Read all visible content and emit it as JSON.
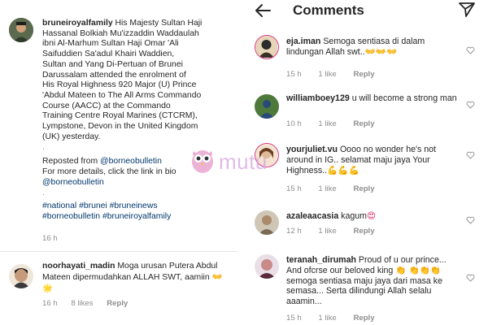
{
  "post": {
    "username": "bruneiroyalfamily",
    "caption_lines": [
      "His Majesty Sultan Haji",
      "Hassanal Bolkiah Mu'izzaddin Waddaulah",
      "ibni Al-Marhum Sultan Haji Omar 'Ali",
      "Saifuddien Sa'adul Khairi Waddien,",
      "Sultan and Yang Di-Pertuan of Brunei",
      "Darussalam attended the enrolment of",
      "His Royal Highness 920 Major (U) Prince",
      "'Abdul Mateen to The All Arms Commando",
      "Course (AACC) at the Commando",
      "Training Centre Royal Marines (CTCRM),",
      "Lympstone, Devon in the United Kingdom",
      "(UK) yesterday."
    ],
    "dot1": ".",
    "repost_prefix": "Reposted from ",
    "repost_link": "@borneobulletin",
    "more_details": "For more details, click the link in bio",
    "bio_link": "@borneobulletin",
    "dot2": ".",
    "hashtags_line1": "#national #brunei #bruneinews",
    "hashtags_line2": "#borneobulletin #bruneiroyalfamily",
    "time": "16 h"
  },
  "left_comment": {
    "username": "noorhayati_madin",
    "text": "Moga urusan Putera Abdul Mateen dipermudahkan ALLAH SWT, aamiin",
    "emoji": "👐🌟",
    "time": "16 h",
    "likes": "8 likes",
    "reply": "Reply"
  },
  "watermark": {
    "text": "mutu"
  },
  "comments_screen": {
    "title": "Comments",
    "comments": [
      {
        "username": "eja.iman",
        "text": "Semoga sentiasa di dalam lindungan Allah swt..",
        "emoji": "👐👐👐",
        "time": "15 h",
        "likes": "1 like",
        "reply": "Reply"
      },
      {
        "username": "williamboey129",
        "text": "u will become a strong man",
        "emoji": "",
        "time": "10 h",
        "likes": "1 like",
        "reply": "Reply"
      },
      {
        "username": "yourjuliet.vu",
        "text": "Oooo no wonder he's not around in IG.. selamat maju jaya Your Highness..",
        "emoji": "💪💪💪",
        "time": "15 h",
        "likes": "1 like",
        "reply": "Reply"
      },
      {
        "username": "azaleaacasia",
        "text": "kagum",
        "emoji": "😍",
        "time": "12 h",
        "likes": "1 like",
        "reply": "Reply"
      },
      {
        "username": "teranah_dirumah",
        "text": "Proud of u our prince... And ofcrse our beloved king",
        "text2": "semoga sentiasa maju jaya dari masa ke semasa... Serta dilindungi Allah selalu aaamin...",
        "emoji": "👏",
        "emoji2": "👏👏👏",
        "time": "15 h",
        "likes": "1 like",
        "reply": "Reply"
      }
    ]
  },
  "icons": [
    "back-arrow-icon",
    "send-icon",
    "heart-icon"
  ],
  "colors": {
    "link": "#00376b",
    "muted": "#8e8e8e",
    "text": "#262626",
    "heart_emoji": "#f0b400"
  }
}
